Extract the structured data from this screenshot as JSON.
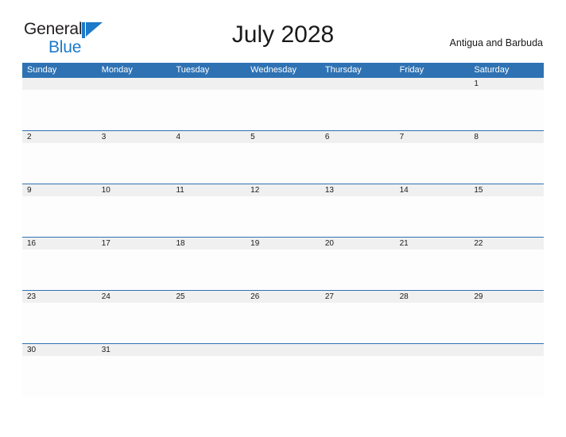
{
  "brand": {
    "name_dark": "General",
    "name_blue": "Blue",
    "flag_icon": "blue-flag-triangle-icon",
    "dark_color": "#231f20",
    "blue_color": "#1c7ac9"
  },
  "header": {
    "month_title": "July 2028",
    "locale": "Antigua and Barbuda"
  },
  "calendar": {
    "accent_color": "#2e72b3",
    "date_strip_color": "#f0f0f0",
    "cell_body_color": "#fdfdfd",
    "weekdays": [
      "Sunday",
      "Monday",
      "Tuesday",
      "Wednesday",
      "Thursday",
      "Friday",
      "Saturday"
    ],
    "weeks": [
      [
        "",
        "",
        "",
        "",
        "",
        "",
        "1"
      ],
      [
        "2",
        "3",
        "4",
        "5",
        "6",
        "7",
        "8"
      ],
      [
        "9",
        "10",
        "11",
        "12",
        "13",
        "14",
        "15"
      ],
      [
        "16",
        "17",
        "18",
        "19",
        "20",
        "21",
        "22"
      ],
      [
        "23",
        "24",
        "25",
        "26",
        "27",
        "28",
        "29"
      ],
      [
        "30",
        "31",
        "",
        "",
        "",
        "",
        ""
      ]
    ]
  }
}
